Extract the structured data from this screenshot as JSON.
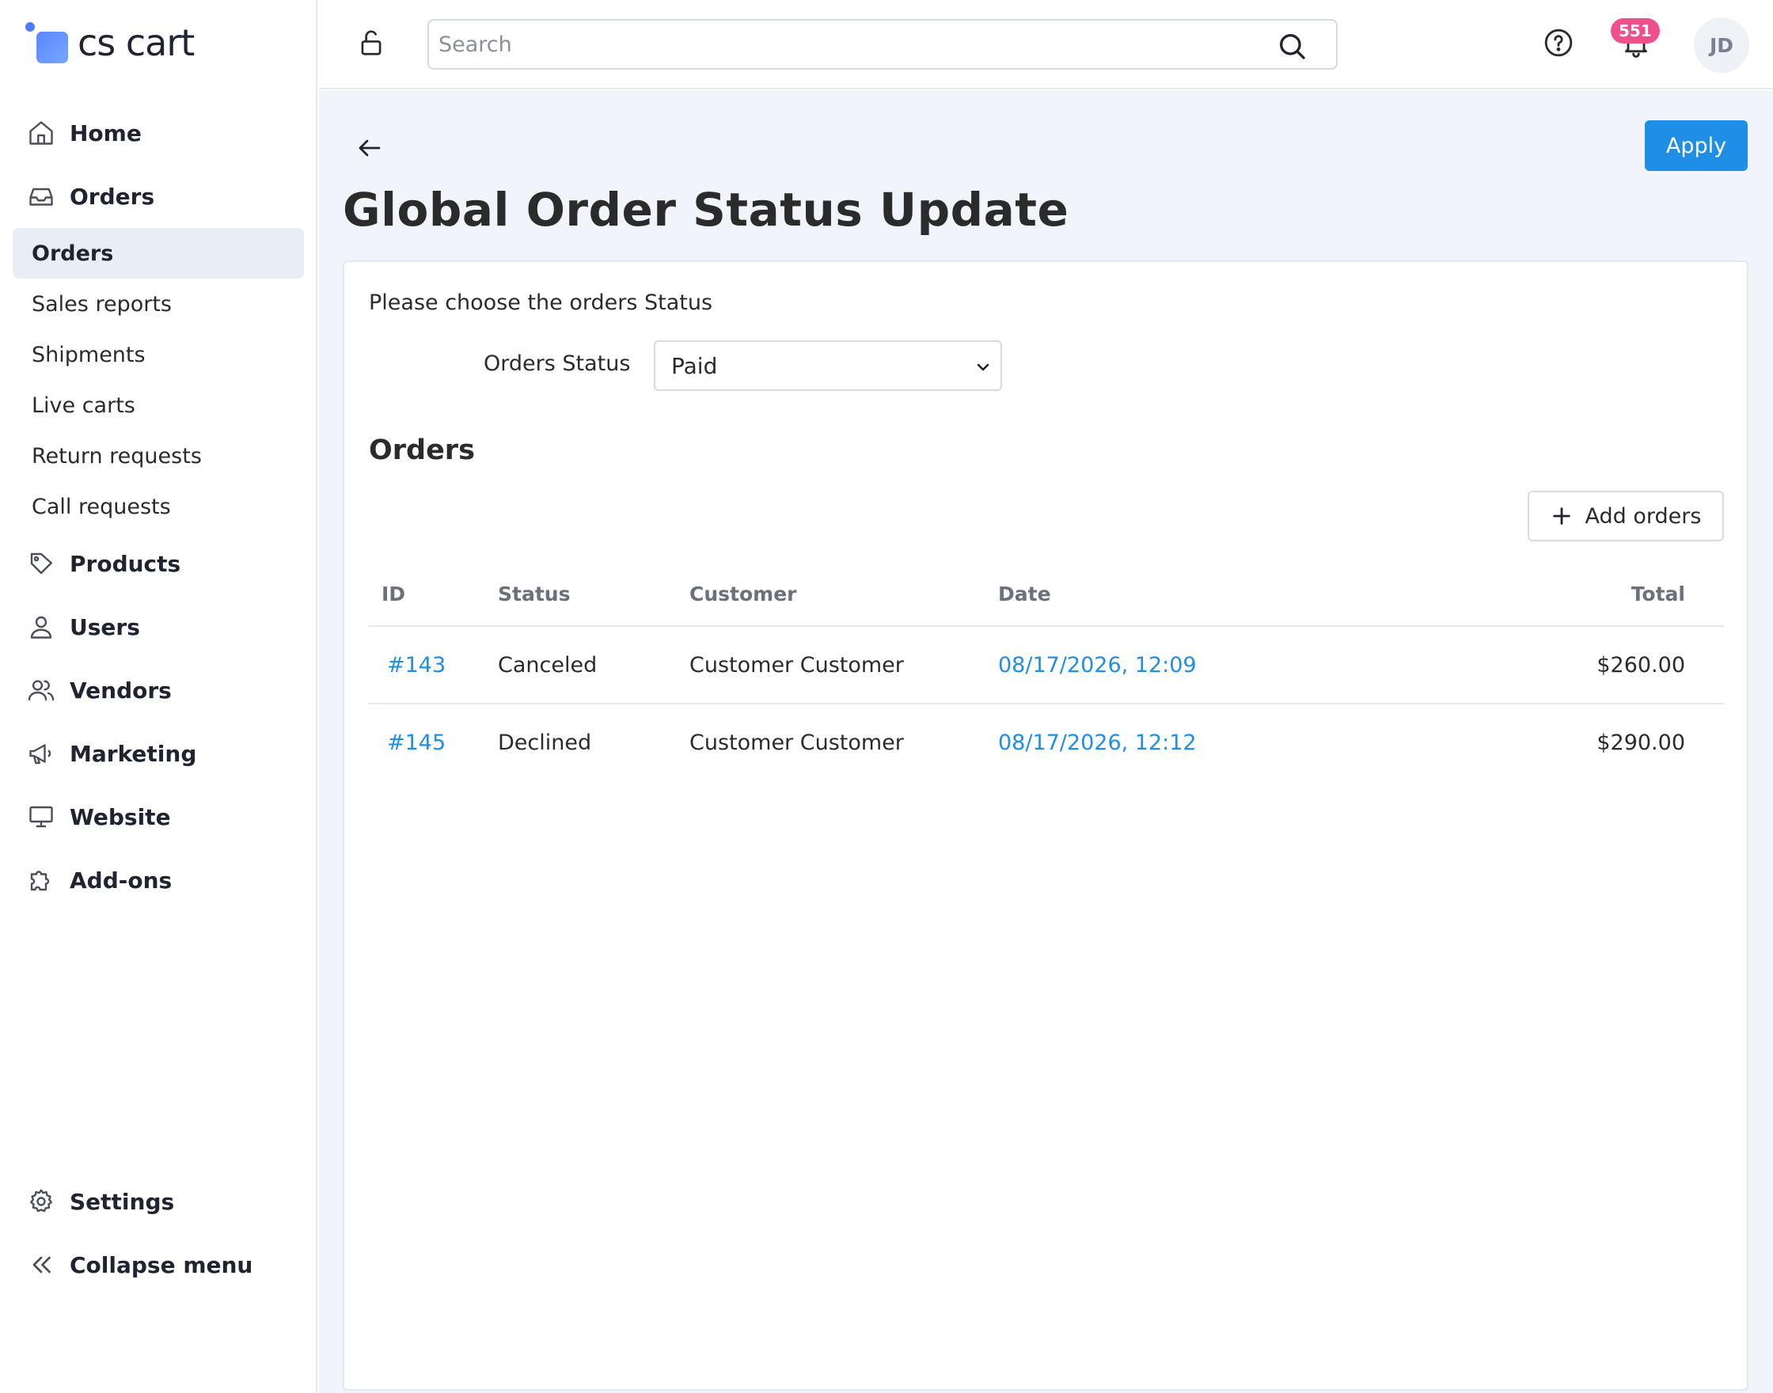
{
  "brand": {
    "name": "cs cart"
  },
  "sidebar": {
    "items": [
      {
        "label": "Home",
        "icon": "home-icon"
      },
      {
        "label": "Orders",
        "icon": "inbox-icon"
      },
      {
        "label": "Products",
        "icon": "tag-icon"
      },
      {
        "label": "Users",
        "icon": "user-icon"
      },
      {
        "label": "Vendors",
        "icon": "users-icon"
      },
      {
        "label": "Marketing",
        "icon": "megaphone-icon"
      },
      {
        "label": "Website",
        "icon": "monitor-icon"
      },
      {
        "label": "Add-ons",
        "icon": "puzzle-icon"
      }
    ],
    "orders_submenu": [
      {
        "label": "Orders",
        "active": true
      },
      {
        "label": "Sales reports",
        "active": false
      },
      {
        "label": "Shipments",
        "active": false
      },
      {
        "label": "Live carts",
        "active": false
      },
      {
        "label": "Return requests",
        "active": false
      },
      {
        "label": "Call requests",
        "active": false
      }
    ],
    "bottom": [
      {
        "label": "Settings",
        "icon": "gear-icon"
      },
      {
        "label": "Collapse menu",
        "icon": "chevrons-left-icon"
      }
    ]
  },
  "topbar": {
    "search_placeholder": "Search",
    "notifications_count": "551",
    "avatar_initials": "JD"
  },
  "page": {
    "title": "Global Order Status Update",
    "apply_label": "Apply",
    "choose_text": "Please choose the orders Status",
    "status_field_label": "Orders Status",
    "status_selected": "Paid",
    "orders_heading": "Orders",
    "add_orders_label": "Add orders"
  },
  "table": {
    "columns": [
      "ID",
      "Status",
      "Customer",
      "Date",
      "Total"
    ],
    "rows": [
      {
        "id": "#143",
        "status": "Canceled",
        "customer": "Customer Customer",
        "date": "08/17/2026, 12:09",
        "total": "$260.00"
      },
      {
        "id": "#145",
        "status": "Declined",
        "customer": "Customer Customer",
        "date": "08/17/2026, 12:12",
        "total": "$290.00"
      }
    ]
  },
  "colors": {
    "accent": "#1e8ee6",
    "badge": "#ef4f8b",
    "main_bg": "#f1f4fa",
    "active_nav_bg": "#e9eef6"
  }
}
